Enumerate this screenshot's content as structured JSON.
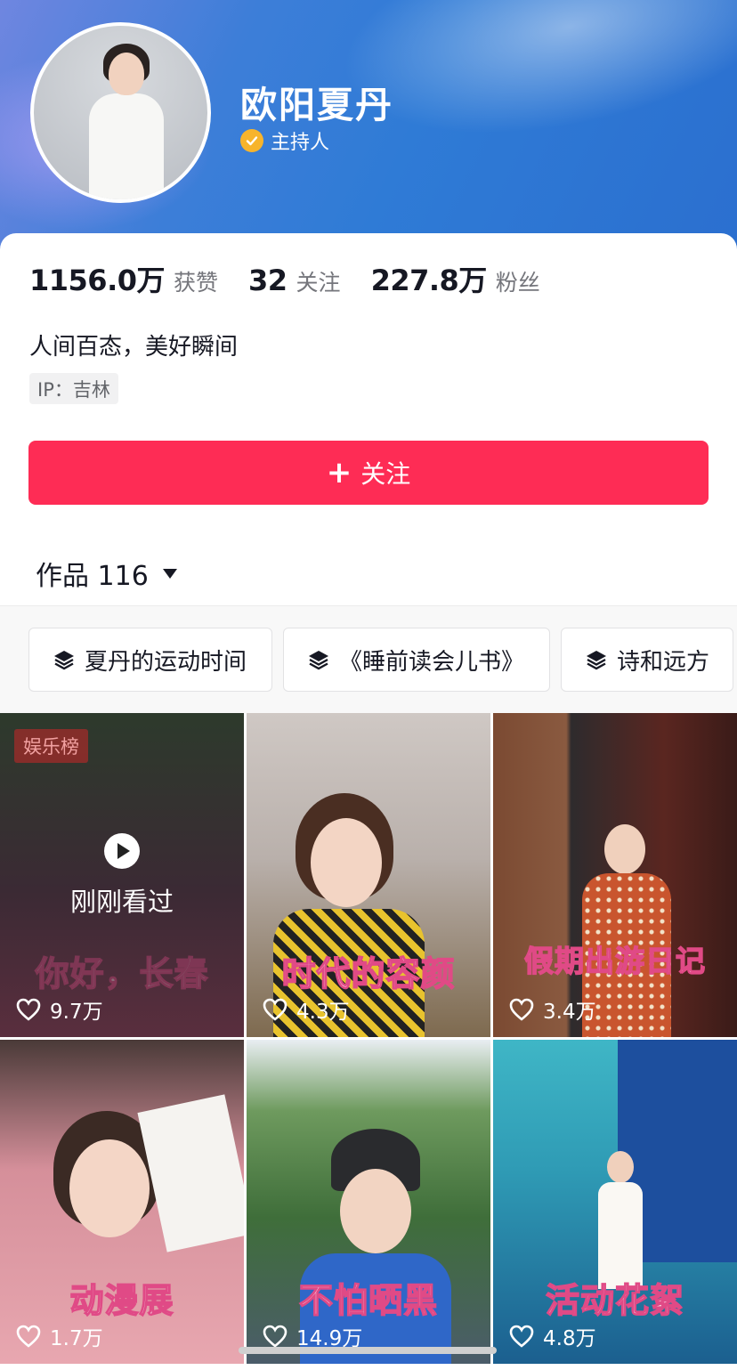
{
  "profile": {
    "name": "欧阳夏丹",
    "role": "主持人"
  },
  "stats": [
    {
      "value": "1156.0万",
      "label": "获赞"
    },
    {
      "value": "32",
      "label": "关注"
    },
    {
      "value": "227.8万",
      "label": "粉丝"
    }
  ],
  "bio": "人间百态，美好瞬间",
  "ip": "IP：吉林",
  "follow_button": {
    "plus": "+",
    "label": "关注"
  },
  "works": {
    "label": "作品 116"
  },
  "collections": [
    {
      "label": "夏丹的运动时间"
    },
    {
      "label": "《睡前读会儿书》"
    },
    {
      "label": "诗和远方"
    }
  ],
  "videos": [
    {
      "badge": "娱乐榜",
      "recent": "刚刚看过",
      "title": "你好，长春",
      "likes": "9.7万"
    },
    {
      "title": "时代的容颜",
      "likes": "4.3万"
    },
    {
      "title": "假期出游日记",
      "likes": "3.4万"
    },
    {
      "title": "动漫展",
      "likes": "1.7万"
    },
    {
      "title": "不怕晒黑",
      "likes": "14.9万"
    },
    {
      "title": "活动花絮",
      "likes": "4.8万"
    }
  ],
  "colors": {
    "accent": "#fe2c55",
    "header": "#2f7bd6",
    "verified": "#f7b42c"
  }
}
